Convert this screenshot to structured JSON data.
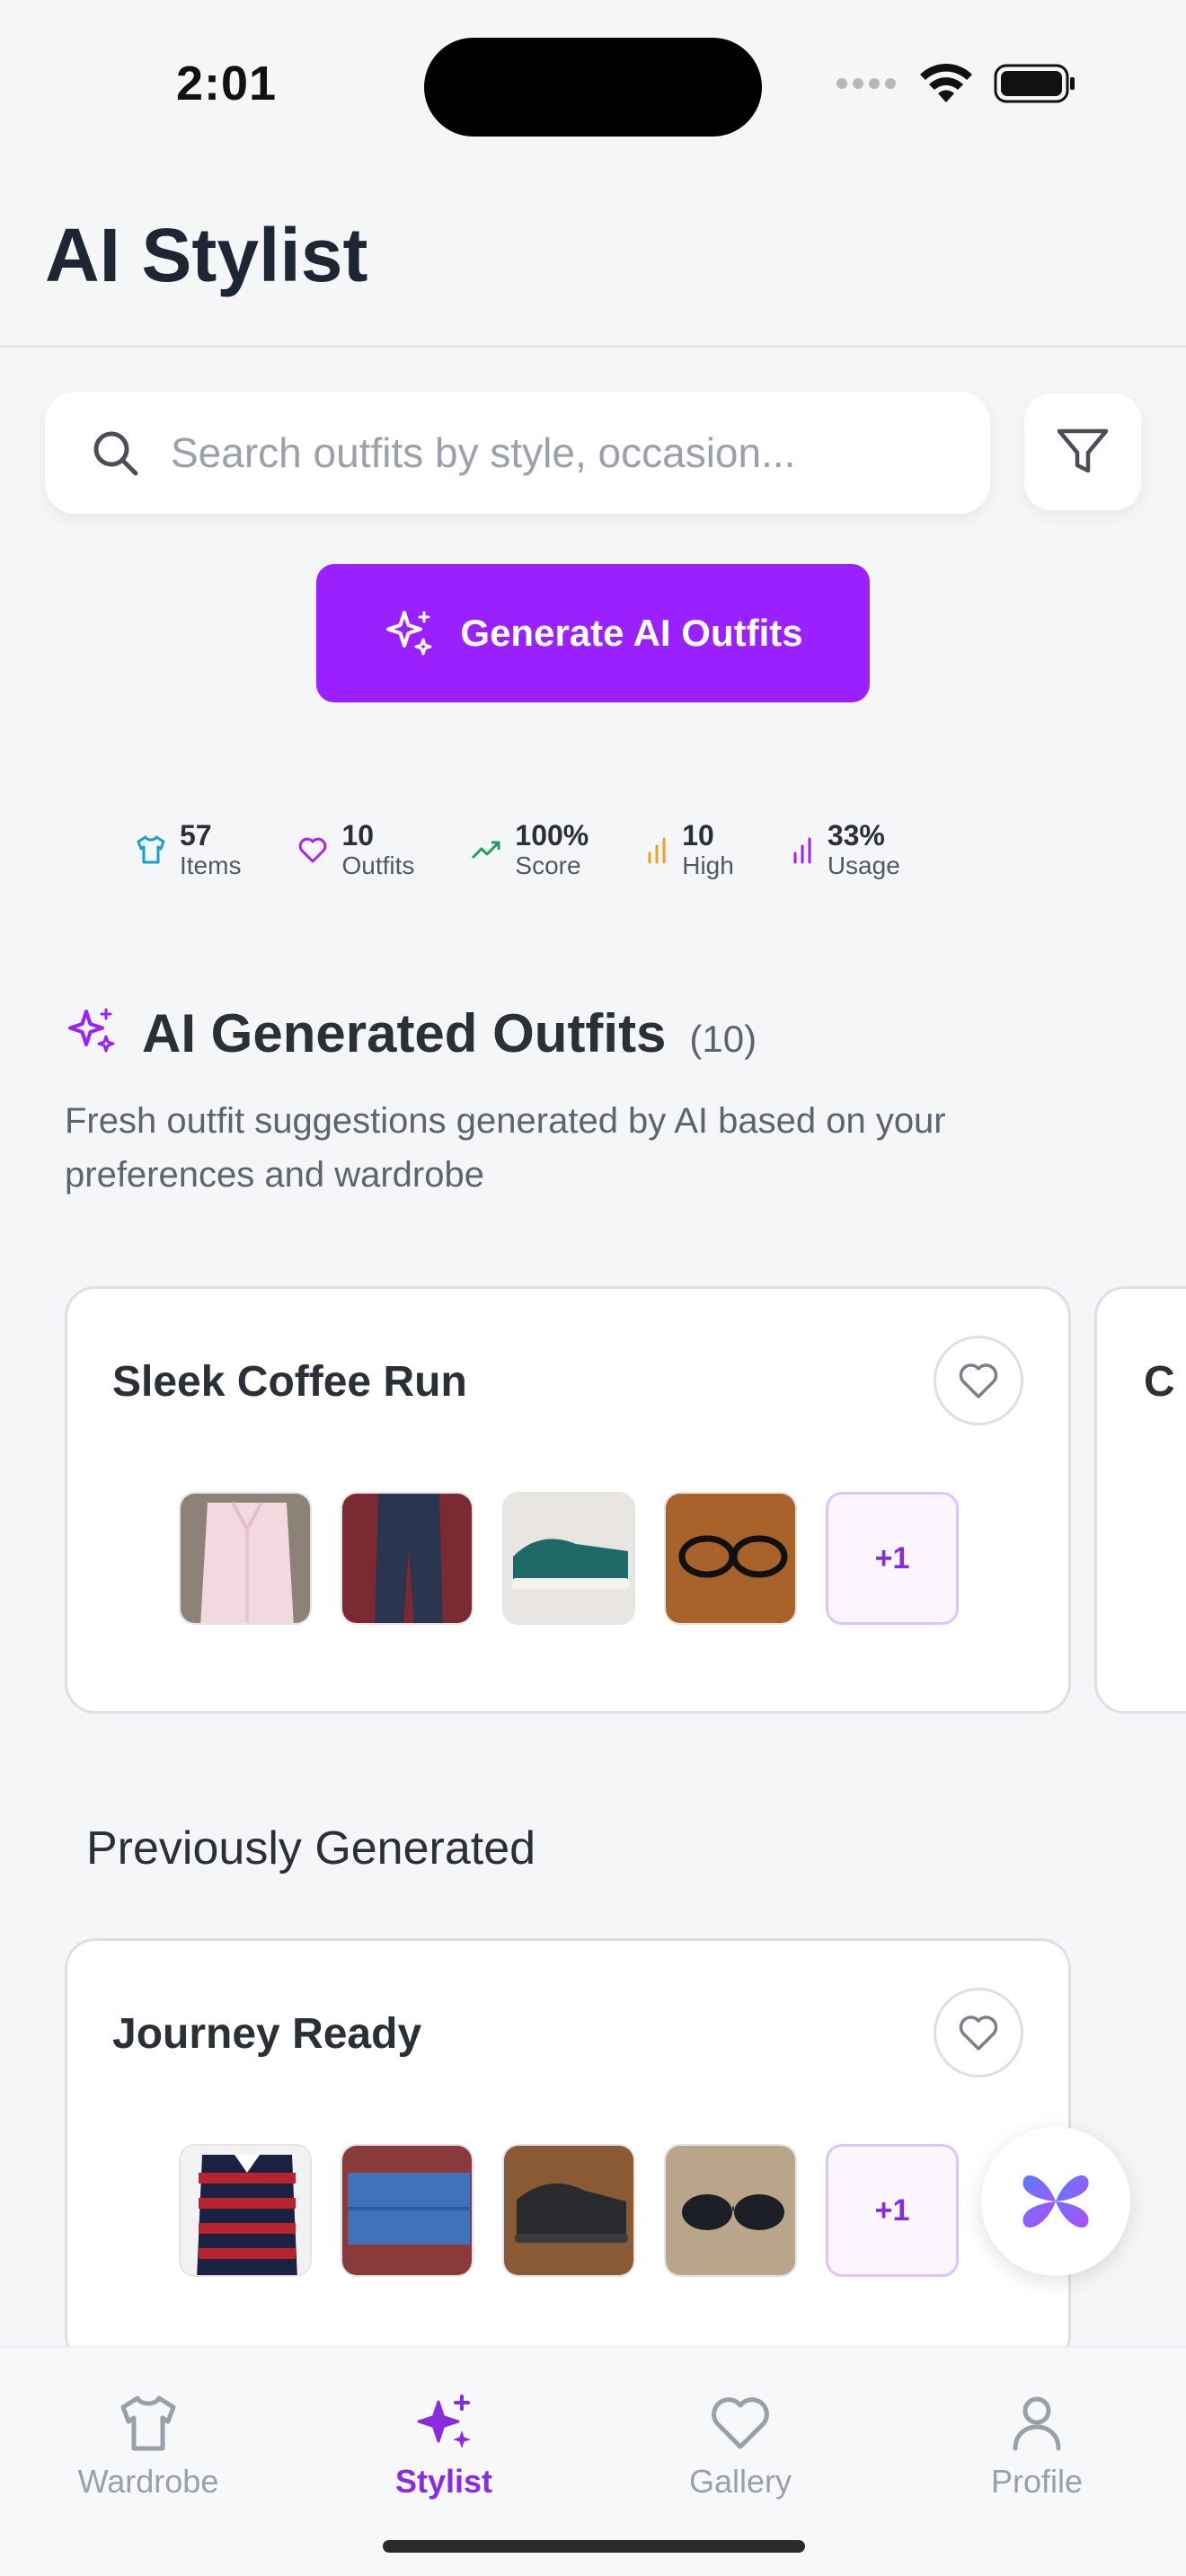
{
  "status_bar": {
    "time": "2:01"
  },
  "header": {
    "title": "AI Stylist"
  },
  "search": {
    "placeholder": "Search outfits by style, occasion...",
    "value": ""
  },
  "generate_button": {
    "label": "Generate AI Outfits"
  },
  "stats": [
    {
      "value": "57",
      "label": "Items",
      "icon": "shirt-icon",
      "color": "#17a2c8"
    },
    {
      "value": "10",
      "label": "Outfits",
      "icon": "heart-icon",
      "color": "#b020e8"
    },
    {
      "value": "100%",
      "label": "Score",
      "icon": "trending-up-icon",
      "color": "#1e9e58"
    },
    {
      "value": "10",
      "label": "High",
      "icon": "bar-chart-icon",
      "color": "#f0a020"
    },
    {
      "value": "33%",
      "label": "Usage",
      "icon": "bar-chart-icon",
      "color": "#9b20ff"
    }
  ],
  "ai_section": {
    "title": "AI Generated Outfits",
    "count": "(10)",
    "description": "Fresh outfit suggestions generated by AI based on your preferences and wardrobe"
  },
  "ai_outfits": [
    {
      "title": "Sleek Coffee Run",
      "items": [
        "pink-shirt",
        "navy-trousers",
        "teal-sneakers",
        "black-glasses"
      ],
      "more": "+1"
    },
    {
      "title": "C"
    }
  ],
  "previous_section": {
    "title": "Previously Generated"
  },
  "previous_outfits": [
    {
      "title": "Journey Ready",
      "items": [
        "striped-rugby-shirt",
        "blue-jeans",
        "black-sneakers",
        "sunglasses"
      ],
      "more": "+1"
    }
  ],
  "tabs": [
    {
      "label": "Wardrobe",
      "icon": "shirt-icon",
      "active": false
    },
    {
      "label": "Stylist",
      "icon": "sparkles-icon",
      "active": true
    },
    {
      "label": "Gallery",
      "icon": "heart-icon",
      "active": false
    },
    {
      "label": "Profile",
      "icon": "user-icon",
      "active": false
    }
  ],
  "colors": {
    "accent": "#9b20ff",
    "tab_active": "#8a2be2",
    "tab_inactive": "#9aa0a8"
  }
}
